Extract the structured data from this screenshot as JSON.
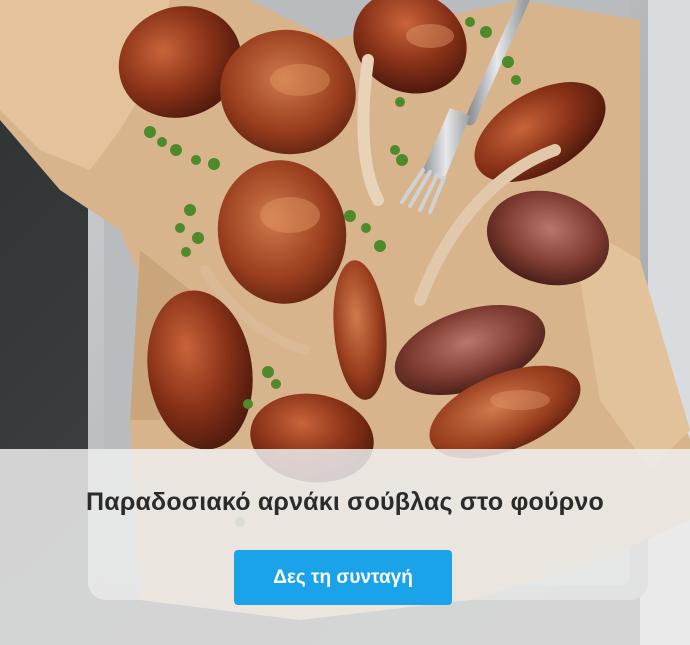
{
  "image": {
    "subject": "Roasted lamb pieces on parchment paper in a metal tray with a fork and oregano",
    "icon": "food-photo"
  },
  "card": {
    "title": "Παραδοσιακό αρνάκι σούβλας στο φούρνο",
    "button_label": "Δες τη συνταγή"
  },
  "colors": {
    "accent": "#1aa3e8",
    "overlay": "#ececec",
    "title_text": "#2b2b2b",
    "button_text": "#ffffff"
  }
}
